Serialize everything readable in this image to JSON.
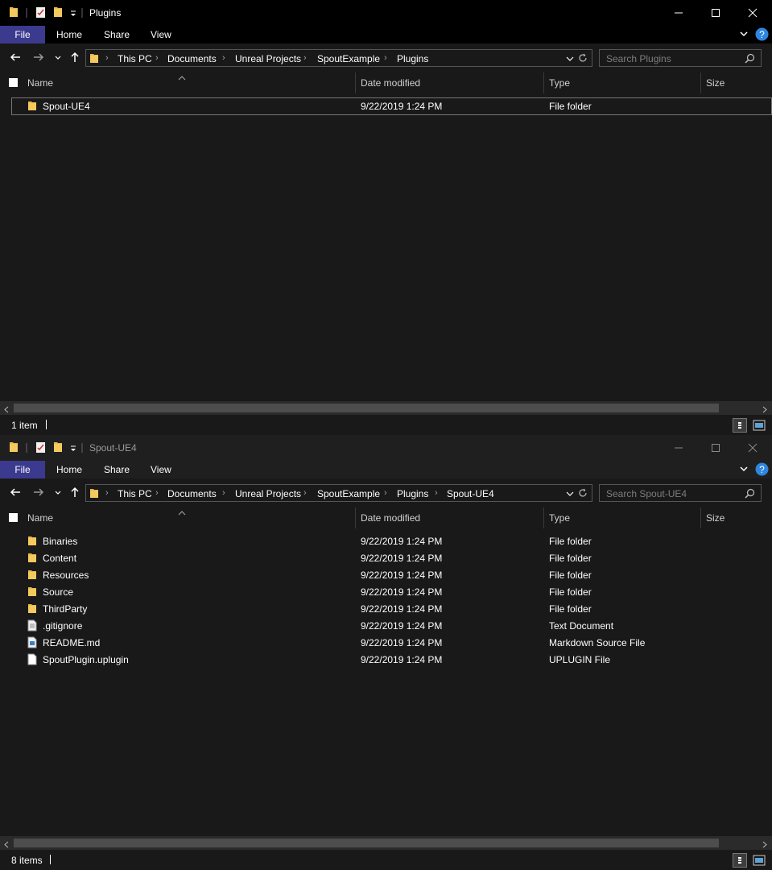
{
  "windows": [
    {
      "title": "Plugins",
      "ribbon_tabs": [
        "File",
        "Home",
        "Share",
        "View"
      ],
      "breadcrumb": [
        "This PC",
        "Documents",
        "Unreal Projects",
        "SpoutExample",
        "Plugins"
      ],
      "search_placeholder": "Search Plugins",
      "columns": [
        "Name",
        "Date modified",
        "Type",
        "Size"
      ],
      "rows": [
        {
          "name": "Spout-UE4",
          "date": "9/22/2019 1:24 PM",
          "type": "File folder",
          "icon": "folder-icon"
        }
      ],
      "status": "1 item"
    },
    {
      "title": "Spout-UE4",
      "ribbon_tabs": [
        "File",
        "Home",
        "Share",
        "View"
      ],
      "breadcrumb": [
        "This PC",
        "Documents",
        "Unreal Projects",
        "SpoutExample",
        "Plugins",
        "Spout-UE4"
      ],
      "search_placeholder": "Search Spout-UE4",
      "columns": [
        "Name",
        "Date modified",
        "Type",
        "Size"
      ],
      "rows": [
        {
          "name": "Binaries",
          "date": "9/22/2019 1:24 PM",
          "type": "File folder",
          "icon": "folder-icon"
        },
        {
          "name": "Content",
          "date": "9/22/2019 1:24 PM",
          "type": "File folder",
          "icon": "folder-icon"
        },
        {
          "name": "Resources",
          "date": "9/22/2019 1:24 PM",
          "type": "File folder",
          "icon": "folder-icon"
        },
        {
          "name": "Source",
          "date": "9/22/2019 1:24 PM",
          "type": "File folder",
          "icon": "folder-icon"
        },
        {
          "name": "ThirdParty",
          "date": "9/22/2019 1:24 PM",
          "type": "File folder",
          "icon": "folder-icon"
        },
        {
          "name": ".gitignore",
          "date": "9/22/2019 1:24 PM",
          "type": "Text Document",
          "icon": "text-file-icon"
        },
        {
          "name": "README.md",
          "date": "9/22/2019 1:24 PM",
          "type": "Markdown Source File",
          "icon": "markdown-file-icon"
        },
        {
          "name": "SpoutPlugin.uplugin",
          "date": "9/22/2019 1:24 PM",
          "type": "UPLUGIN File",
          "icon": "blank-file-icon"
        }
      ],
      "status": "8 items"
    }
  ],
  "colors": {
    "accent_file_tab": "#3b3a8e",
    "folder": "#e8b84a",
    "background": "#191919"
  }
}
